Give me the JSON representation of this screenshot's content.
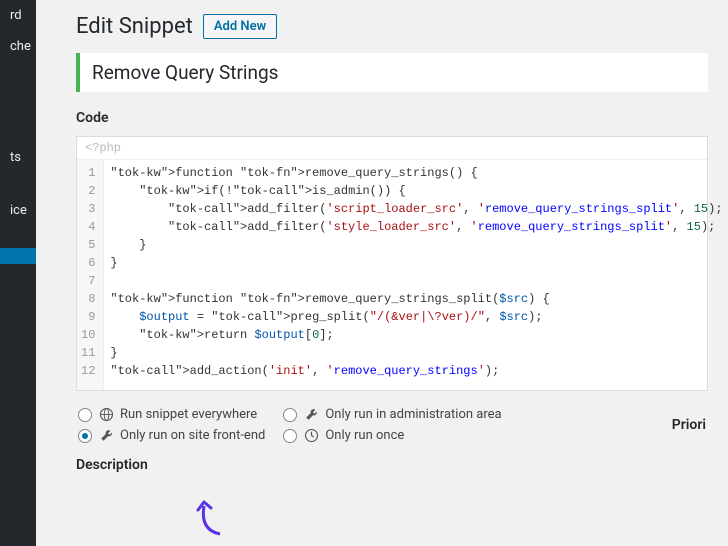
{
  "sidebar": {
    "items": [
      "rd",
      "che",
      "",
      "",
      "ts",
      "",
      "ice",
      ""
    ]
  },
  "header": {
    "page_title": "Edit Snippet",
    "add_new": "Add New"
  },
  "snippet": {
    "title": "Remove Query Strings"
  },
  "labels": {
    "code": "Code",
    "description": "Description",
    "priority": "Priori"
  },
  "editor": {
    "prefix": "<?php",
    "lines": [
      {
        "n": 1,
        "raw": "function remove_query_strings() {"
      },
      {
        "n": 2,
        "raw": "    if(!is_admin()) {"
      },
      {
        "n": 3,
        "raw": "        add_filter('script_loader_src', 'remove_query_strings_split', 15);"
      },
      {
        "n": 4,
        "raw": "        add_filter('style_loader_src', 'remove_query_strings_split', 15);"
      },
      {
        "n": 5,
        "raw": "    }"
      },
      {
        "n": 6,
        "raw": "}"
      },
      {
        "n": 7,
        "raw": ""
      },
      {
        "n": 8,
        "raw": "function remove_query_strings_split($src) {"
      },
      {
        "n": 9,
        "raw": "    $output = preg_split(\"/(&ver|\\?ver)/\", $src);"
      },
      {
        "n": 10,
        "raw": "    return $output[0];"
      },
      {
        "n": 11,
        "raw": "}"
      },
      {
        "n": 12,
        "raw": "add_action('init', 'remove_query_strings');"
      }
    ]
  },
  "scope": {
    "options": [
      {
        "id": "everywhere",
        "label": "Run snippet everywhere",
        "icon": "globe",
        "checked": false
      },
      {
        "id": "admin",
        "label": "Only run in administration area",
        "icon": "wrench",
        "checked": false
      },
      {
        "id": "frontend",
        "label": "Only run on site front-end",
        "icon": "wrench",
        "checked": true
      },
      {
        "id": "once",
        "label": "Only run once",
        "icon": "clock",
        "checked": false
      }
    ]
  }
}
